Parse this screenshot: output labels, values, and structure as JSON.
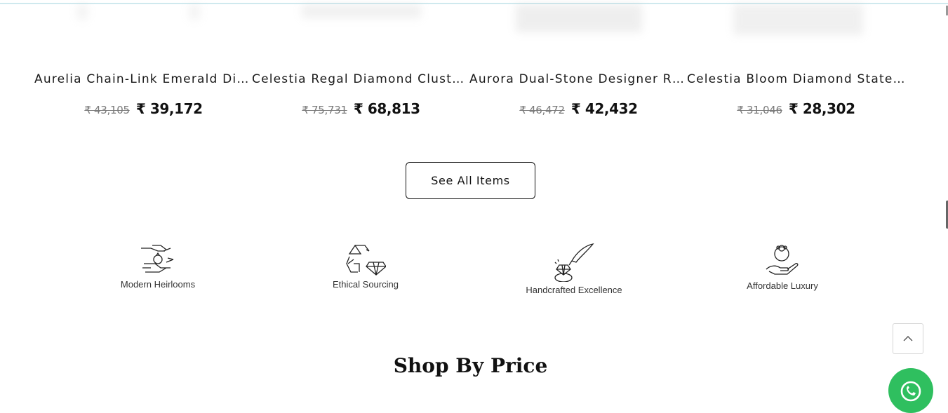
{
  "products": [
    {
      "name": "Aurelia Chain-Link Emerald Diam…",
      "old_price": "₹ 43,105",
      "new_price": "₹ 39,172"
    },
    {
      "name": "Celestia Regal Diamond Cluster …",
      "old_price": "₹ 75,731",
      "new_price": "₹ 68,813"
    },
    {
      "name": "Aurora Dual-Stone Designer Ring",
      "old_price": "₹ 46,472",
      "new_price": "₹ 42,432"
    },
    {
      "name": "Celestia Bloom Diamond Statem…",
      "old_price": "₹ 31,046",
      "new_price": "₹ 28,302"
    }
  ],
  "see_all_label": "See All Items",
  "features": [
    {
      "label": "Modern Heirlooms",
      "icon": "heirloom-hands-icon"
    },
    {
      "label": "Ethical Sourcing",
      "icon": "recycle-diamond-icon"
    },
    {
      "label": "Handcrafted Excellence",
      "icon": "ring-quill-icon"
    },
    {
      "label": "Affordable Luxury",
      "icon": "hand-ring-icon"
    }
  ],
  "section_heading": "Shop By Price",
  "scroll_top_icon": "chevron-up-icon",
  "chat_icon": "whatsapp-icon",
  "colors": {
    "whatsapp": "#2fbf5f",
    "top_line": "#cfe9ee"
  }
}
